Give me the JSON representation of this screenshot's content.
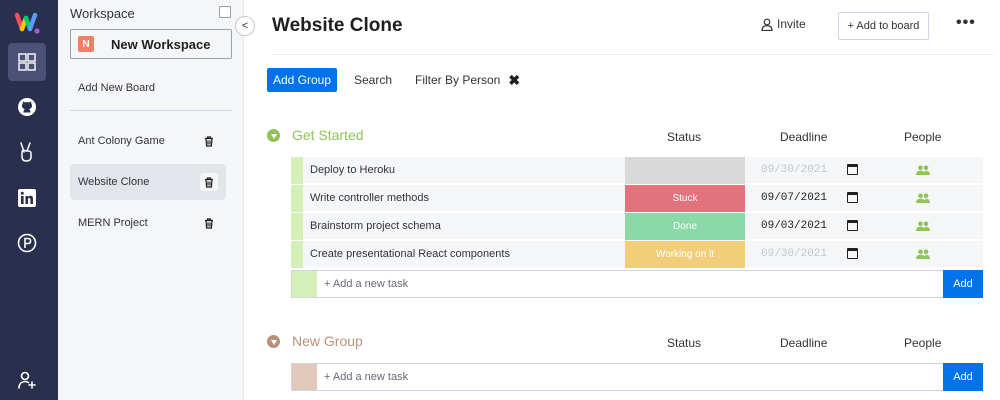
{
  "rail": {
    "icons": [
      "logo-icon",
      "boards-icon",
      "github-icon",
      "victory-icon",
      "linkedin-icon",
      "portfolio-icon",
      "add-user-icon"
    ]
  },
  "workspace": {
    "title": "Workspace",
    "new_workspace_badge": "N",
    "new_workspace_label": "New Workspace",
    "add_new_board": "Add New Board",
    "collapse_label": "<",
    "boards": [
      {
        "label": "Ant Colony Game"
      },
      {
        "label": "Website Clone",
        "active": true
      },
      {
        "label": "MERN Project"
      }
    ]
  },
  "header": {
    "title": "Website Clone",
    "invite_label": "Invite",
    "add_to_board_label": "+ Add to board",
    "more_label": "•••"
  },
  "toolbar": {
    "add_group_label": "Add Group",
    "search_label": "Search",
    "filter_label": "Filter By Person",
    "filter_clear": "✖"
  },
  "colors": {
    "primary": "#0073ea",
    "group1": "#9cd326",
    "group2": "#a9836b",
    "stuck": "#e2445c",
    "done": "#00c875",
    "working": "#fdab3d"
  },
  "groups": [
    {
      "name": "Get Started",
      "color": "#8fc35a",
      "bar_color": "#d4f0b8",
      "columns": {
        "status": "Status",
        "deadline": "Deadline",
        "people": "People"
      },
      "tasks": [
        {
          "name": "Deploy to Heroku",
          "status": "",
          "status_color": "#d9d9d9",
          "date": "09/30/2021",
          "date_muted": true
        },
        {
          "name": "Write controller methods",
          "status": "Stuck",
          "status_color": "#e2737d",
          "date": "09/07/2021",
          "date_muted": false
        },
        {
          "name": "Brainstorm project schema",
          "status": "Done",
          "status_color": "#8bd9a6",
          "date": "09/03/2021",
          "date_muted": false
        },
        {
          "name": "Create presentational React components",
          "status": "Working on it",
          "status_color": "#f3ce7a",
          "date": "09/30/2021",
          "date_muted": true
        }
      ],
      "add_task_placeholder": "+ Add a new task",
      "add_button": "Add"
    },
    {
      "name": "New Group",
      "color": "#b8927a",
      "bar_color": "#e2c7bb",
      "columns": {
        "status": "Status",
        "deadline": "Deadline",
        "people": "People"
      },
      "tasks": [],
      "add_task_placeholder": "+ Add a new task",
      "add_button": "Add"
    }
  ]
}
